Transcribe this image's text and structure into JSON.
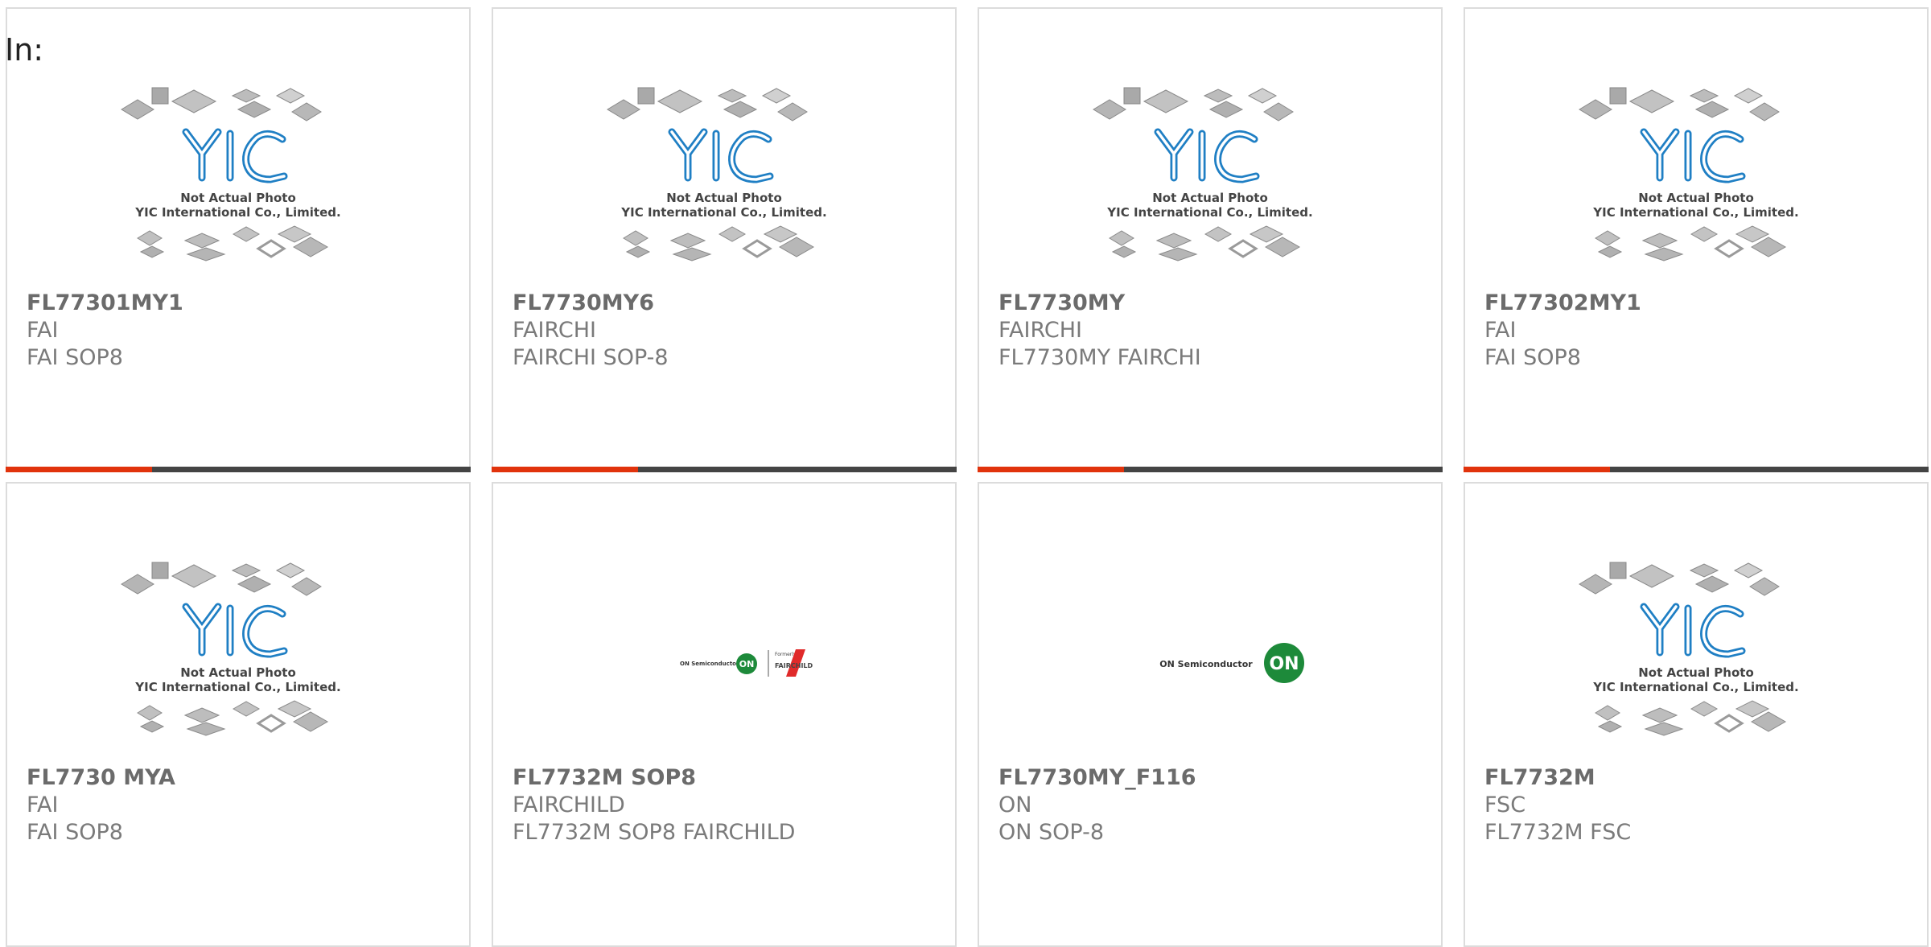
{
  "prefix": "In:",
  "colors": {
    "accent": "#e1330c",
    "bar": "#444444",
    "logo_blue": "#1f7fc4",
    "on_green": "#1d8a3a",
    "fairchild_red": "#e02a2a"
  },
  "placeholder": {
    "line1": "Not Actual Photo",
    "line2": "YIC International Co., Limited."
  },
  "logos": {
    "on_semi_text": "ON Semiconductor",
    "on_badge": "ON",
    "formerly": "Formerly",
    "fairchild": "FAIRCHILD"
  },
  "products": [
    {
      "part": "FL77301MY1",
      "maker": "FAI",
      "desc": "FAI SOP8",
      "image": "yic-placeholder",
      "bar": true
    },
    {
      "part": "FL7730MY6",
      "maker": "FAIRCHI",
      "desc": "FAIRCHI SOP-8",
      "image": "yic-placeholder",
      "bar": true
    },
    {
      "part": "FL7730MY",
      "maker": "FAIRCHI",
      "desc": "FL7730MY FAIRCHI",
      "image": "yic-placeholder",
      "bar": true
    },
    {
      "part": "FL77302MY1",
      "maker": "FAI",
      "desc": "FAI SOP8",
      "image": "yic-placeholder",
      "bar": true
    },
    {
      "part": "FL7730 MYA",
      "maker": "FAI",
      "desc": "FAI SOP8",
      "image": "yic-placeholder",
      "bar": false
    },
    {
      "part": "FL7732M SOP8",
      "maker": "FAIRCHILD",
      "desc": "FL7732M SOP8 FAIRCHILD",
      "image": "on-fairchild-logo",
      "bar": false
    },
    {
      "part": "FL7730MY_F116",
      "maker": "ON",
      "desc": "ON SOP-8",
      "image": "on-semi-logo",
      "bar": false
    },
    {
      "part": "FL7732M",
      "maker": "FSC",
      "desc": "FL7732M FSC",
      "image": "yic-placeholder",
      "bar": false
    }
  ]
}
